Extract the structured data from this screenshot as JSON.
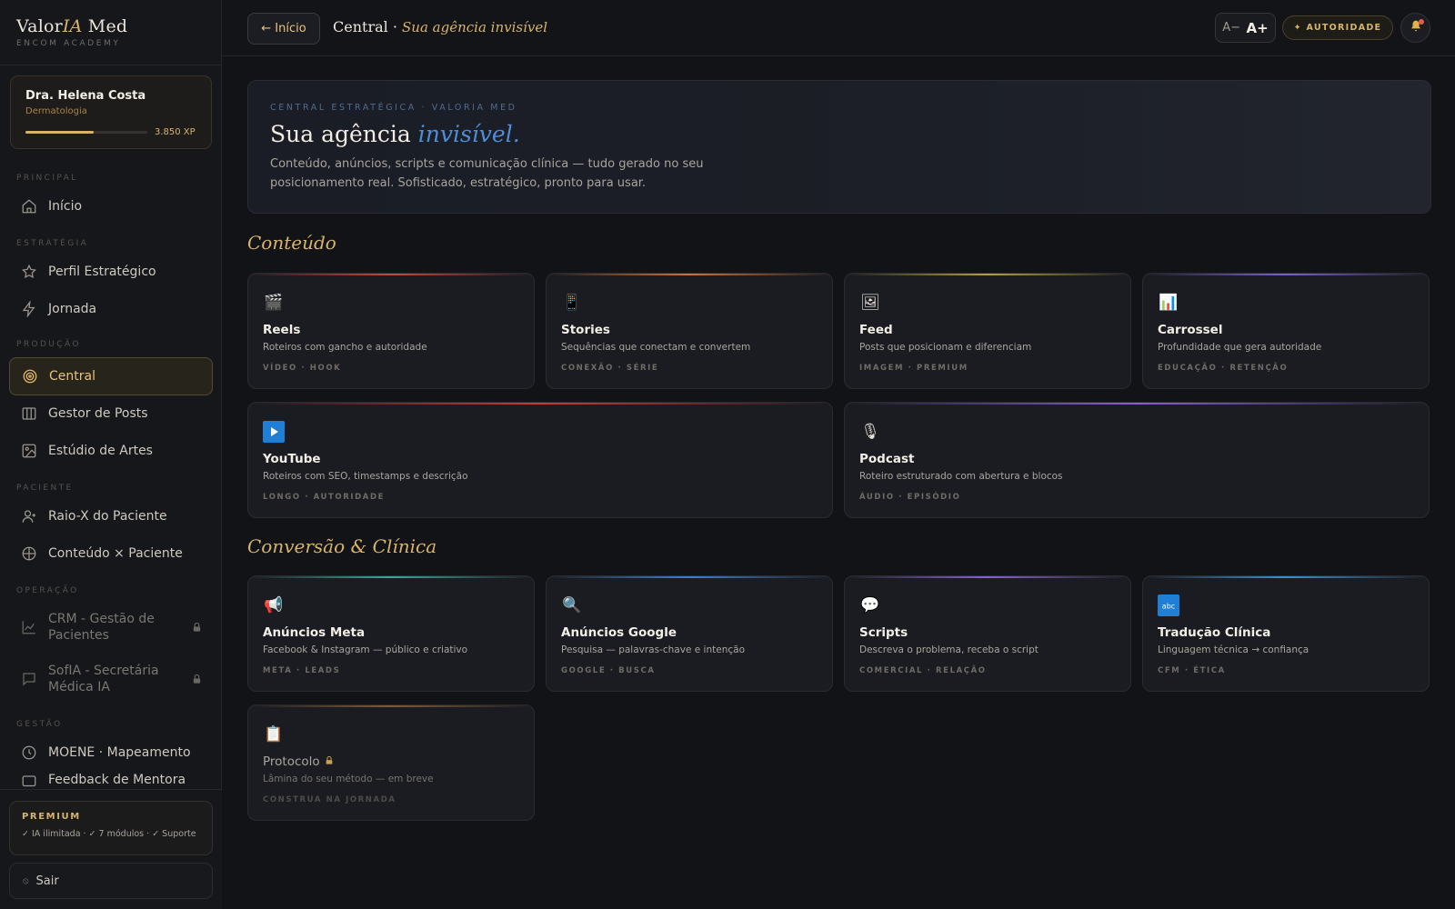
{
  "brand": {
    "name_part1": "Valor",
    "name_part2": "IA",
    "name_part3": " Med",
    "subtitle": "ENCOM ACADEMY"
  },
  "profile": {
    "name": "Dra. Helena Costa",
    "specialty": "Dermatologia",
    "xp": "3.850 XP",
    "progress_fraction": 0.56
  },
  "nav": {
    "sections": {
      "principal": "PRINCIPAL",
      "estrategia": "ESTRATÉGIA",
      "producao": "PRODUÇÃO",
      "paciente": "PACIENTE",
      "operacao": "OPERAÇÃO",
      "gestao": "GESTÃO"
    },
    "items": {
      "inicio": "Início",
      "perfil": "Perfil Estratégico",
      "jornada": "Jornada",
      "central": "Central",
      "gestor": "Gestor de Posts",
      "estudio": "Estúdio de Artes",
      "raiox": "Raio-X do Paciente",
      "conteudo_paciente": "Conteúdo × Paciente",
      "crm": "CRM - Gestão de Pacientes",
      "sofia": "SofIA - Secretária Médica IA",
      "moene": "MOENE · Mapeamento",
      "feedback": "Feedback de Mentora"
    }
  },
  "premium": {
    "title": "PREMIUM",
    "features": "✓ IA ilimitada · ✓ 7 módulos · ✓ Suporte"
  },
  "logout": {
    "label": "Sair"
  },
  "topbar": {
    "back_label": "← Início",
    "crumb_main": "Central",
    "crumb_sep": " · ",
    "crumb_sub": "Sua agência invisível",
    "font_minus": "A−",
    "font_plus": "A+",
    "authority": "✦ AUTORIDADE"
  },
  "hero": {
    "eyebrow": "CENTRAL ESTRATÉGICA · VALORIA MED",
    "title_plain": "Sua agência ",
    "title_accent": "invisível.",
    "description": "Conteúdo, anúncios, scripts e comunicação clínica — tudo gerado no seu posicionamento real. Sofisticado, estratégico, pronto para usar."
  },
  "sections": {
    "conteudo": "Conteúdo",
    "conversao": "Conversão & Clínica"
  },
  "content_cards": [
    {
      "icon": "clapperboard",
      "glyph": "🎬",
      "title": "Reels",
      "desc": "Roteiros com gancho e autoridade",
      "tags": "VÍDEO · HOOK",
      "accent": "#c9473f"
    },
    {
      "icon": "mobile-phone",
      "glyph": "📱",
      "title": "Stories",
      "desc": "Sequências que conectam e convertem",
      "tags": "CONEXÃO · SÉRIE",
      "accent": "#c9743a"
    },
    {
      "icon": "picture",
      "glyph": "🖼",
      "title": "Feed",
      "desc": "Posts que posicionam e diferenciam",
      "tags": "IMAGEM · PREMIUM",
      "accent": "#b3a03a"
    },
    {
      "icon": "bar-chart",
      "glyph": "📊",
      "title": "Carrossel",
      "desc": "Profundidade que gera autoridade",
      "tags": "EDUCAÇÃO · RETENÇÃO",
      "accent": "#7b62c9"
    },
    {
      "icon": "play-button",
      "glyph": "▶",
      "title": "YouTube",
      "desc": "Roteiros com SEO, timestamps e descrição",
      "tags": "LONGO · AUTORIDADE",
      "accent": "#c93b3b"
    },
    {
      "icon": "microphone",
      "glyph": "🎙",
      "title": "Podcast",
      "desc": "Roteiro estruturado com abertura e blocos",
      "tags": "ÁUDIO · EPISÓDIO",
      "accent": "#8a5fd0"
    }
  ],
  "conversion_cards": [
    {
      "icon": "megaphone",
      "glyph": "📢",
      "title": "Anúncios Meta",
      "desc": "Facebook & Instagram — público e criativo",
      "tags": "META · LEADS",
      "accent": "#3fa59b"
    },
    {
      "icon": "magnifier",
      "glyph": "🔍",
      "title": "Anúncios Google",
      "desc": "Pesquisa — palavras-chave e intenção",
      "tags": "GOOGLE · BUSCA",
      "accent": "#3f7fc9"
    },
    {
      "icon": "speech-bubble",
      "glyph": "💬",
      "title": "Scripts",
      "desc": "Descreva o problema, receba o script",
      "tags": "COMERCIAL · RELAÇÃO",
      "accent": "#8a62c9"
    },
    {
      "icon": "abc-input",
      "glyph": "abc",
      "title": "Tradução Clínica",
      "desc": "Linguagem técnica → confiança",
      "tags": "CFM · ÉTICA",
      "accent": "#3f8fc9"
    },
    {
      "icon": "clipboard",
      "glyph": "📋",
      "title": "Protocolo",
      "desc": "Lâmina do seu método — em breve",
      "tags": "CONSTRUA NA JORNADA",
      "accent": "#7a5a3a",
      "locked": true
    }
  ],
  "colors": {
    "gold": "#d8b46a",
    "blue_accent": "#4f8ed6",
    "background": "#121317",
    "card": "#1b1c21"
  }
}
